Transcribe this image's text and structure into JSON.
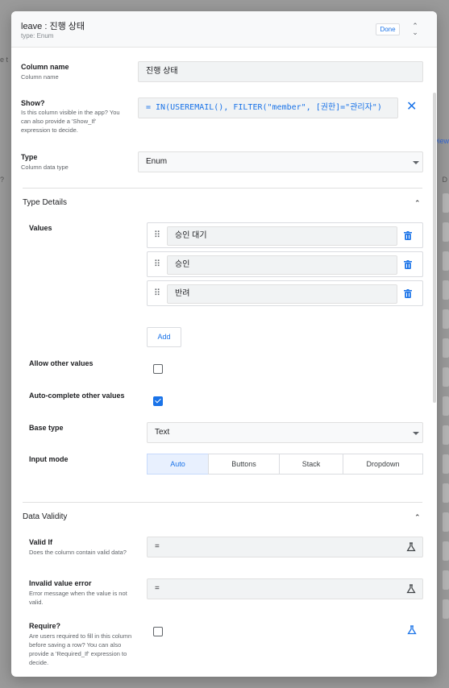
{
  "background": {
    "left_text": "e t",
    "left_q": "?",
    "right_link": "view",
    "right_d": "D"
  },
  "header": {
    "title": "leave : 진행 상태",
    "subtitle": "type: Enum",
    "done_label": "Done"
  },
  "column_name": {
    "label": "Column name",
    "description": "Column name",
    "value": "진행 상태"
  },
  "show": {
    "label": "Show?",
    "description": "Is this column visible in the app? You can also provide a 'Show_If' expression to decide.",
    "expression": "= IN(USEREMAIL(), FILTER(\"member\", [권한]=\"관리자\")"
  },
  "type": {
    "label": "Type",
    "description": "Column data type",
    "value": "Enum"
  },
  "type_details": {
    "title": "Type Details",
    "values_label": "Values",
    "values": [
      "승인 대기",
      "승인",
      "반려"
    ],
    "add_label": "Add",
    "allow_other_label": "Allow other values",
    "allow_other_checked": false,
    "autocomplete_label": "Auto-complete other values",
    "autocomplete_checked": true,
    "base_type_label": "Base type",
    "base_type_value": "Text",
    "input_mode_label": "Input mode",
    "input_modes": [
      "Auto",
      "Buttons",
      "Stack",
      "Dropdown"
    ],
    "input_mode_selected": "Auto"
  },
  "data_validity": {
    "title": "Data Validity",
    "valid_if_label": "Valid If",
    "valid_if_description": "Does the column contain valid data?",
    "valid_if_value": "=",
    "invalid_error_label": "Invalid value error",
    "invalid_error_description": "Error message when the value is not valid.",
    "invalid_error_value": "=",
    "require_label": "Require?",
    "require_description": "Are users required to fill in this column before saving a row? You can also provide a 'Required_If' expression to decide.",
    "require_checked": false
  },
  "colors": {
    "accent": "#1a73e8",
    "input_bg": "#f1f3f4"
  }
}
